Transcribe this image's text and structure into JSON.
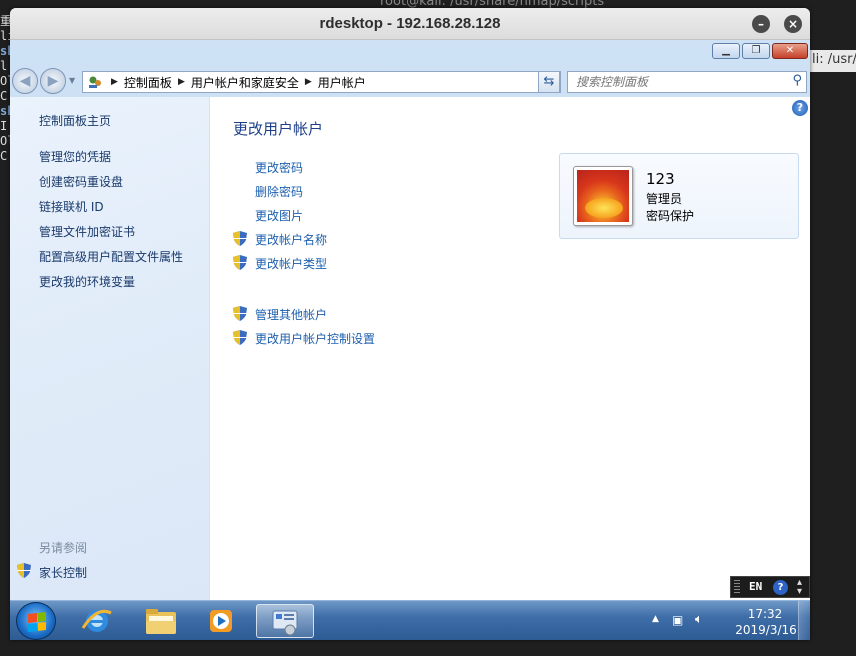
{
  "host": {
    "bg_terminal_title": "root@kali: /usr/share/nmap/scripts",
    "right_window_title": "li: /usr/s",
    "left_strip_text": [
      "重",
      "li",
      "sh",
      "l",
      "Ol",
      "C",
      "sh",
      "I",
      "Ol",
      "C"
    ]
  },
  "rdesktop": {
    "title": "rdesktop - 192.168.28.128",
    "minimize_symbol": "–",
    "close_symbol": "×"
  },
  "window": {
    "caption_buttons": {
      "minimize": "▁",
      "maximize": "❐",
      "close": "✕"
    }
  },
  "address": {
    "breadcrumb": [
      "控制面板",
      "用户帐户和家庭安全",
      "用户帐户"
    ],
    "search_placeholder": "搜索控制面板"
  },
  "sidebar": {
    "home": "控制面板主页",
    "items": [
      "管理您的凭据",
      "创建密码重设盘",
      "链接联机 ID",
      "管理文件加密证书",
      "配置高级用户配置文件属性",
      "更改我的环境变量"
    ],
    "see_also": "另请参阅",
    "parental": "家长控制"
  },
  "main": {
    "title": "更改用户帐户",
    "links": [
      {
        "label": "更改密码",
        "shield": false
      },
      {
        "label": "删除密码",
        "shield": false
      },
      {
        "label": "更改图片",
        "shield": false
      },
      {
        "label": "更改帐户名称",
        "shield": true
      },
      {
        "label": "更改帐户类型",
        "shield": true
      }
    ],
    "links2": [
      {
        "label": "管理其他帐户",
        "shield": true
      },
      {
        "label": "更改用户帐户控制设置",
        "shield": true
      }
    ],
    "help_symbol": "?"
  },
  "user": {
    "name": "123",
    "role": "管理员",
    "password_status": "密码保护"
  },
  "taskbar": {
    "time": "17:32",
    "date": "2019/3/16"
  },
  "langbar": {
    "lang": "EN",
    "help": "?"
  },
  "colors": {
    "link": "#1c5fae",
    "title": "#1e3f8a",
    "sidebar_text": "#1a3a6b"
  }
}
